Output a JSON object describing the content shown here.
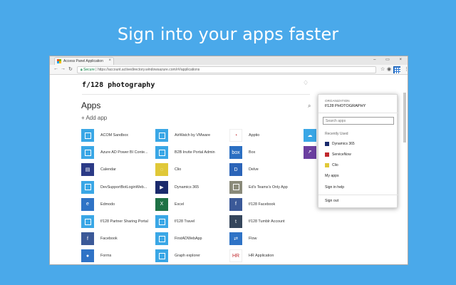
{
  "headline": "Sign into your apps faster",
  "browser": {
    "tab_title": "Access Panel Application",
    "tab_close": "×",
    "window_controls": "– ▭ ×",
    "secure_label": "Secure",
    "url": "https://account.activedirectory.windowsazure.com/r#/applications",
    "nav_back": "←",
    "nav_forward": "→",
    "nav_reload": "↻",
    "star": "☆",
    "menu": "⋮"
  },
  "page": {
    "brand": "f/128 photography",
    "title": "Apps",
    "add_app": "+ Add app",
    "search_symbol": "⌕",
    "bell": "♢"
  },
  "apps": [
    {
      "label": "ACOM Sandbox",
      "color": "#3aa7e6",
      "glyph": "",
      "col": 0,
      "row": 0
    },
    {
      "label": "Azure AD Power BI Conte...",
      "color": "#3aa7e6",
      "glyph": "",
      "col": 0,
      "row": 1
    },
    {
      "label": "Calendar",
      "color": "#2b3a86",
      "glyph": "▤",
      "col": 0,
      "row": 2
    },
    {
      "label": "DevSupportBotLoginWeb...",
      "color": "#3aa7e6",
      "glyph": "",
      "col": 0,
      "row": 3
    },
    {
      "label": "Edmodo",
      "color": "#2f73c6",
      "glyph": "e",
      "col": 0,
      "row": 4
    },
    {
      "label": "f/128 Partner Sharing Portal",
      "color": "#3aa7e6",
      "glyph": "",
      "col": 0,
      "row": 5
    },
    {
      "label": "Facebook",
      "color": "#3b5998",
      "glyph": "f",
      "col": 0,
      "row": 6
    },
    {
      "label": "Forms",
      "color": "#2f73c6",
      "glyph": "●",
      "col": 0,
      "row": 7
    },
    {
      "label": "AirWatch by VMware",
      "color": "#3aa7e6",
      "glyph": "",
      "col": 1,
      "row": 0
    },
    {
      "label": "B2B Invite Portal Admin",
      "color": "#3aa7e6",
      "glyph": "",
      "col": 1,
      "row": 1
    },
    {
      "label": "Clio",
      "color": "#e0c838",
      "glyph": "◌",
      "col": 1,
      "row": 2
    },
    {
      "label": "Dynamics 365",
      "color": "#1a2a6c",
      "glyph": "▶",
      "col": 1,
      "row": 3
    },
    {
      "label": "Excel",
      "color": "#1e7145",
      "glyph": "X",
      "col": 1,
      "row": 4
    },
    {
      "label": "f/128 Travel",
      "color": "#3aa7e6",
      "glyph": "",
      "col": 1,
      "row": 5
    },
    {
      "label": "FirstADWebApp",
      "color": "#3aa7e6",
      "glyph": "",
      "col": 1,
      "row": 6
    },
    {
      "label": "Graph explorer",
      "color": "#3aa7e6",
      "glyph": "",
      "col": 1,
      "row": 7
    },
    {
      "label": "Apptio",
      "color": "#ffffff",
      "glyph": "◔",
      "col": 2,
      "row": 0
    },
    {
      "label": "Box",
      "color": "#2b6fc2",
      "glyph": "box",
      "col": 2,
      "row": 1
    },
    {
      "label": "Delve",
      "color": "#2b64b8",
      "glyph": "D",
      "col": 2,
      "row": 2
    },
    {
      "label": "Ed's Teams's Only App",
      "color": "#8a8a7a",
      "glyph": "",
      "col": 2,
      "row": 3
    },
    {
      "label": "f/128 Facebook",
      "color": "#3b5998",
      "glyph": "f",
      "col": 2,
      "row": 4
    },
    {
      "label": "f/128 Tumblr Account",
      "color": "#35465c",
      "glyph": "t",
      "col": 2,
      "row": 5
    },
    {
      "label": "Flow",
      "color": "#2f73c6",
      "glyph": "⇄",
      "col": 2,
      "row": 6
    },
    {
      "label": "HR Application",
      "color": "#ffffff",
      "glyph": "HR",
      "col": 2,
      "row": 7
    }
  ],
  "apps_partial": [
    {
      "color": "#3aa7e6",
      "glyph": "☁",
      "row": 0
    },
    {
      "color": "#6b3fa0",
      "glyph": "ዖ",
      "row": 1
    }
  ],
  "dropdown": {
    "org_label": "ORGANIZATION",
    "org_name": "f/128 PHOTOGRAPHY",
    "search_placeholder": "Search apps",
    "recently_used": "Recently Used",
    "recent": [
      {
        "label": "Dynamics 365",
        "color": "#1a2a6c"
      },
      {
        "label": "ServiceNow",
        "color": "#c0282d"
      },
      {
        "label": "Clio",
        "color": "#e0c838"
      }
    ],
    "my_apps": "My apps",
    "sign_in_help": "Sign in help",
    "sign_out": "Sign out"
  }
}
